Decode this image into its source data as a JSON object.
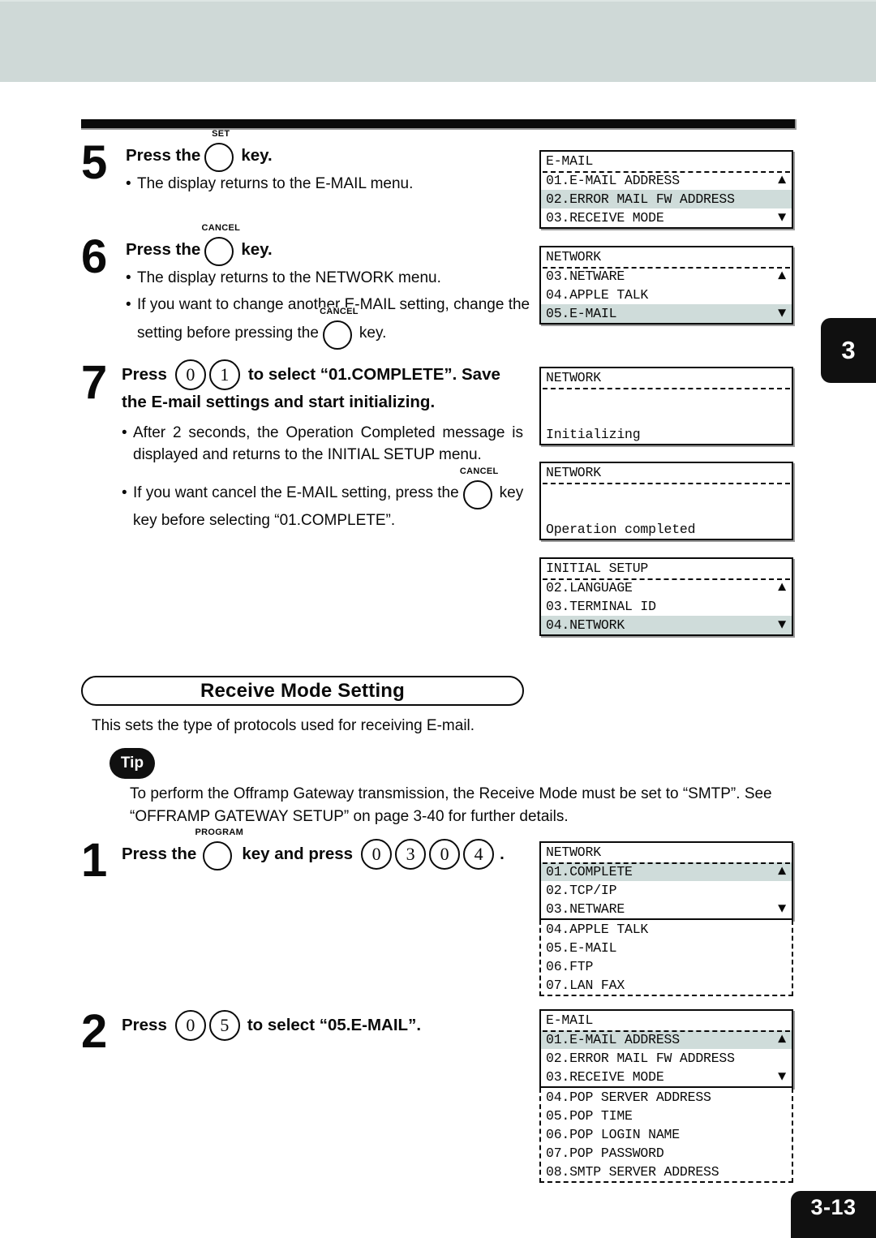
{
  "page": {
    "chapter_tab": "3",
    "page_number": "3-13"
  },
  "steps": [
    {
      "number": "5",
      "head_parts": [
        "Press the",
        "key."
      ],
      "key_caption": "SET",
      "bullets": [
        "The display returns to the E-MAIL menu."
      ]
    },
    {
      "number": "6",
      "head_parts": [
        "Press the",
        "key."
      ],
      "key_caption": "CANCEL",
      "bullets": [
        "The display returns to the NETWORK menu.",
        "If you want to change another E-MAIL setting, change the",
        "setting before pressing the",
        "key."
      ],
      "inline_key_caption": "CANCEL"
    },
    {
      "number": "7",
      "head_line1_pre": "Press",
      "head_line1_keys": [
        "0",
        "1"
      ],
      "head_line1_post": "to select “01.COMPLETE”.  Save",
      "head_line2": "the E-mail settings and start initializing.",
      "bullets": [
        "After 2 seconds, the Operation Completed message is displayed and returns to the INITIAL SETUP menu.",
        "If you want cancel the E-MAIL setting, press the",
        "key before selecting “01.COMPLETE”.",
        "CANCEL"
      ]
    }
  ],
  "section": {
    "title": "Receive Mode Setting",
    "description": "This sets the type of protocols used for receiving E-mail.",
    "tip_label": "Tip",
    "tip_text": "To perform the Offramp Gateway transmission, the Receive Mode must be set to “SMTP”.  See “OFFRAMP GATEWAY SETUP” on page 3-40 for further details."
  },
  "bottom_steps": [
    {
      "number": "1",
      "pre": "Press the",
      "key_caption": "PROGRAM",
      "mid": "key and press",
      "keys": [
        "0",
        "3",
        "0",
        "4"
      ],
      "post": "."
    },
    {
      "number": "2",
      "pre": "Press",
      "keys": [
        "0",
        "5"
      ],
      "post": "to select “05.E-MAIL”."
    }
  ],
  "lcd_panels": [
    {
      "id": "email-menu-1",
      "title": "E-MAIL",
      "rows": [
        {
          "text": "01.E-MAIL ADDRESS",
          "highlight": false,
          "arrow": "▲"
        },
        {
          "text": "02.ERROR MAIL FW ADDRESS",
          "highlight": true,
          "arrow": ""
        },
        {
          "text": "03.RECEIVE MODE",
          "highlight": false,
          "arrow": "▼"
        }
      ],
      "extension": []
    },
    {
      "id": "network-menu-1",
      "title": "NETWORK",
      "rows": [
        {
          "text": "03.NETWARE",
          "highlight": false,
          "arrow": "▲"
        },
        {
          "text": "04.APPLE TALK",
          "highlight": false,
          "arrow": ""
        },
        {
          "text": "05.E-MAIL",
          "highlight": true,
          "arrow": "▼"
        }
      ],
      "extension": []
    },
    {
      "id": "network-initializing",
      "title": "NETWORK",
      "rows": [
        {
          "text": "",
          "highlight": false,
          "arrow": ""
        },
        {
          "text": "",
          "highlight": false,
          "arrow": ""
        },
        {
          "text": "Initializing",
          "highlight": false,
          "arrow": ""
        }
      ],
      "extension": []
    },
    {
      "id": "network-completed",
      "title": "NETWORK",
      "rows": [
        {
          "text": "",
          "highlight": false,
          "arrow": ""
        },
        {
          "text": "",
          "highlight": false,
          "arrow": ""
        },
        {
          "text": "Operation completed",
          "highlight": false,
          "arrow": ""
        }
      ],
      "extension": []
    },
    {
      "id": "initial-setup-menu",
      "title": "INITIAL SETUP",
      "rows": [
        {
          "text": "02.LANGUAGE",
          "highlight": false,
          "arrow": "▲"
        },
        {
          "text": "03.TERMINAL ID",
          "highlight": false,
          "arrow": ""
        },
        {
          "text": "04.NETWORK",
          "highlight": true,
          "arrow": "▼"
        }
      ],
      "extension": []
    },
    {
      "id": "network-menu-2",
      "title": "NETWORK",
      "rows": [
        {
          "text": "01.COMPLETE",
          "highlight": true,
          "arrow": "▲"
        },
        {
          "text": "02.TCP/IP",
          "highlight": false,
          "arrow": ""
        },
        {
          "text": "03.NETWARE",
          "highlight": false,
          "arrow": "▼"
        }
      ],
      "extension": [
        "04.APPLE TALK",
        "05.E-MAIL",
        "06.FTP",
        "07.LAN FAX"
      ]
    },
    {
      "id": "email-menu-2",
      "title": "E-MAIL",
      "rows": [
        {
          "text": "01.E-MAIL ADDRESS",
          "highlight": true,
          "arrow": "▲"
        },
        {
          "text": "02.ERROR MAIL FW ADDRESS",
          "highlight": false,
          "arrow": ""
        },
        {
          "text": "03.RECEIVE MODE",
          "highlight": false,
          "arrow": "▼"
        }
      ],
      "extension": [
        "04.POP SERVER ADDRESS",
        "05.POP TIME",
        "06.POP LOGIN NAME",
        "07.POP PASSWORD",
        "08.SMTP SERVER ADDRESS"
      ]
    }
  ],
  "colors": {
    "ink": "#0a0a0a",
    "lcd_highlight": "#cfdcda",
    "scan_band": "#cfd9d7"
  }
}
